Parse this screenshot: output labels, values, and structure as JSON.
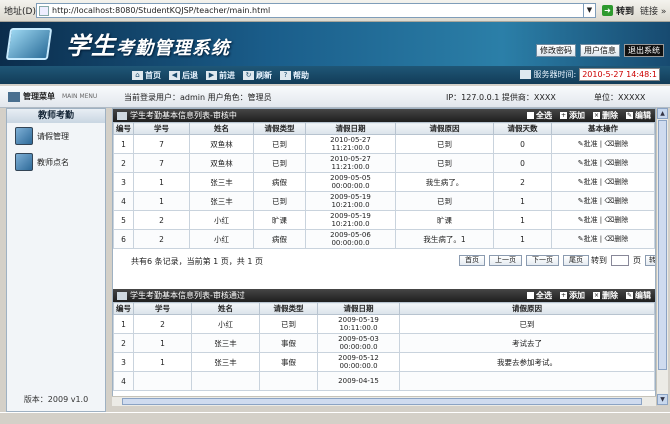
{
  "browser": {
    "address_label": "地址(D)",
    "url": "http://localhost:8080/StudentKQJSP/teacher/main.html",
    "go_label": "转到",
    "links_label": "链接 »"
  },
  "banner": {
    "title_a": "学生",
    "title_b": "考勤管理系统",
    "buttons": [
      "修改密码",
      "用户信息",
      "退出系统"
    ]
  },
  "nav": {
    "items": [
      {
        "icon": "home-icon",
        "label": "首页"
      },
      {
        "icon": "back-icon",
        "label": "后退"
      },
      {
        "icon": "forward-icon",
        "label": "前进"
      },
      {
        "icon": "refresh-icon",
        "label": "刷新"
      },
      {
        "icon": "help-icon",
        "label": "帮助"
      }
    ],
    "time_label": "服务器时间:",
    "time_value": "2010-5-27 14:48:1"
  },
  "infobar": {
    "menu_title": "管理菜单",
    "menu_sub": "MAIN MENU",
    "user": "当前登录用户：admin  用户角色：管理员",
    "ip": "IP：127.0.0.1     提供商：XXXX",
    "unit": "单位：XXXXX"
  },
  "sidebar": {
    "header": "教师考勤",
    "items": [
      "请假管理",
      "教师点名"
    ],
    "version": "版本：2009 v1.0"
  },
  "panel1": {
    "title": "学生考勤基本信息列表-审核中",
    "ops": [
      "全选",
      "添加",
      "删除",
      "编辑"
    ],
    "columns": [
      "编号",
      "学号",
      "姓名",
      "请假类型",
      "请假日期",
      "请假原因",
      "请假天数",
      "基本操作"
    ],
    "rows": [
      [
        "1",
        "7",
        "双鱼林",
        "已到",
        "2010-05-27",
        "11:21:00.0",
        "已到",
        "0"
      ],
      [
        "2",
        "7",
        "双鱼林",
        "已到",
        "2010-05-27",
        "11:21:00.0",
        "已到",
        "0"
      ],
      [
        "3",
        "1",
        "张三丰",
        "病假",
        "2009-05-05",
        "00:00:00.0",
        "我生病了。",
        "2"
      ],
      [
        "4",
        "1",
        "张三丰",
        "已到",
        "2009-05-19",
        "10:21:00.0",
        "已到",
        "1"
      ],
      [
        "5",
        "2",
        "小红",
        "旷课",
        "2009-05-19",
        "10:21:00.0",
        "旷课",
        "1"
      ],
      [
        "6",
        "2",
        "小红",
        "病假",
        "2009-05-06",
        "00:00:00.0",
        "我生病了。1",
        "1"
      ]
    ],
    "row_ops": [
      "批准",
      "删除"
    ],
    "pager": {
      "info": "共有6 条记录，当前第 1 页，共 1 页",
      "buttons": [
        "首页",
        "上一页",
        "下一页",
        "尾页"
      ],
      "jump_label": "转到",
      "page_suffix": "页",
      "go": "转到"
    }
  },
  "panel2": {
    "title": "学生考勤基本信息列表-审核通过",
    "ops": [
      "全选",
      "添加",
      "删除",
      "编辑"
    ],
    "columns": [
      "编号",
      "学号",
      "姓名",
      "请假类型",
      "请假日期",
      "请假原因"
    ],
    "rows": [
      [
        "1",
        "2",
        "小红",
        "已到",
        "2009-05-19",
        "10:11:00.0",
        "已到"
      ],
      [
        "2",
        "1",
        "张三丰",
        "事假",
        "2009-05-03",
        "00:00:00.0",
        "考试去了"
      ],
      [
        "3",
        "1",
        "张三丰",
        "事假",
        "2009-05-12",
        "00:00:00.0",
        "我要去参加考试。"
      ],
      [
        "4",
        "",
        "",
        "",
        "2009-04-15",
        "",
        ""
      ]
    ]
  }
}
